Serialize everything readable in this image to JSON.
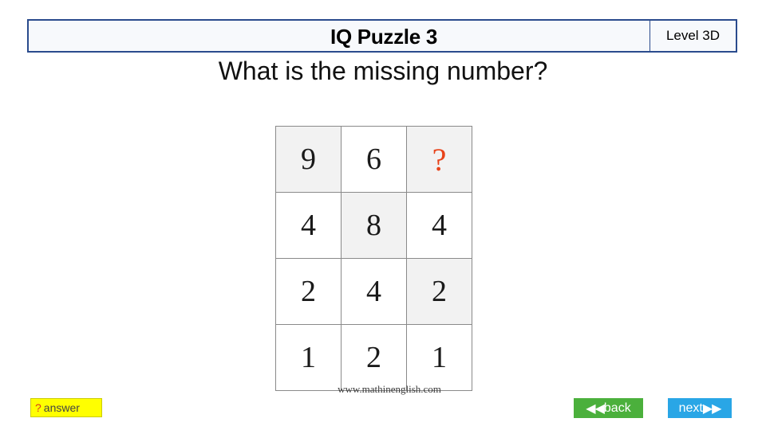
{
  "header": {
    "title": "IQ Puzzle 3",
    "level": "Level 3D"
  },
  "question": "What is the missing number?",
  "puzzle": {
    "rows": [
      [
        {
          "value": "9",
          "shaded": true,
          "missing": false
        },
        {
          "value": "6",
          "shaded": false,
          "missing": false
        },
        {
          "value": "?",
          "shaded": true,
          "missing": true
        }
      ],
      [
        {
          "value": "4",
          "shaded": false,
          "missing": false
        },
        {
          "value": "8",
          "shaded": true,
          "missing": false
        },
        {
          "value": "4",
          "shaded": false,
          "missing": false
        }
      ],
      [
        {
          "value": "2",
          "shaded": false,
          "missing": false
        },
        {
          "value": "4",
          "shaded": false,
          "missing": false
        },
        {
          "value": "2",
          "shaded": true,
          "missing": false
        }
      ],
      [
        {
          "value": "1",
          "shaded": false,
          "missing": false
        },
        {
          "value": "2",
          "shaded": false,
          "missing": false
        },
        {
          "value": "1",
          "shaded": false,
          "missing": false
        }
      ]
    ]
  },
  "watermark": "www.mathinenglish.com",
  "footer": {
    "answer_mark": "?",
    "answer_label": "answer",
    "back_arrows": "◀◀",
    "back_label": "back",
    "next_label": "next",
    "next_arrows": "▶▶"
  },
  "colors": {
    "header_border": "#2a4b8d",
    "question_mark": "#e8431a",
    "answer_bg": "#ffff00",
    "back_bg": "#4bb03c",
    "next_bg": "#29a6e6"
  }
}
